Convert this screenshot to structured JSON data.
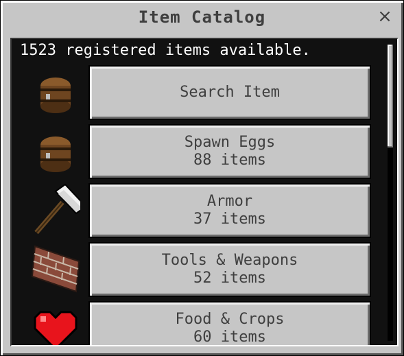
{
  "window": {
    "title": "Item Catalog",
    "close_label": "×"
  },
  "catalog": {
    "summary": "1523 registered items available.",
    "scroll_position": 0.0,
    "items": [
      {
        "label": "Search Item",
        "count": "",
        "icon": "chest-icon"
      },
      {
        "label": "Spawn Eggs",
        "count": "88 items",
        "icon": "chest-icon"
      },
      {
        "label": "Armor",
        "count": "37 items",
        "icon": "hammer-icon"
      },
      {
        "label": "Tools & Weapons",
        "count": "52 items",
        "icon": "brick-icon"
      },
      {
        "label": "Food & Crops",
        "count": "60 items",
        "icon": "heart-icon"
      }
    ]
  }
}
